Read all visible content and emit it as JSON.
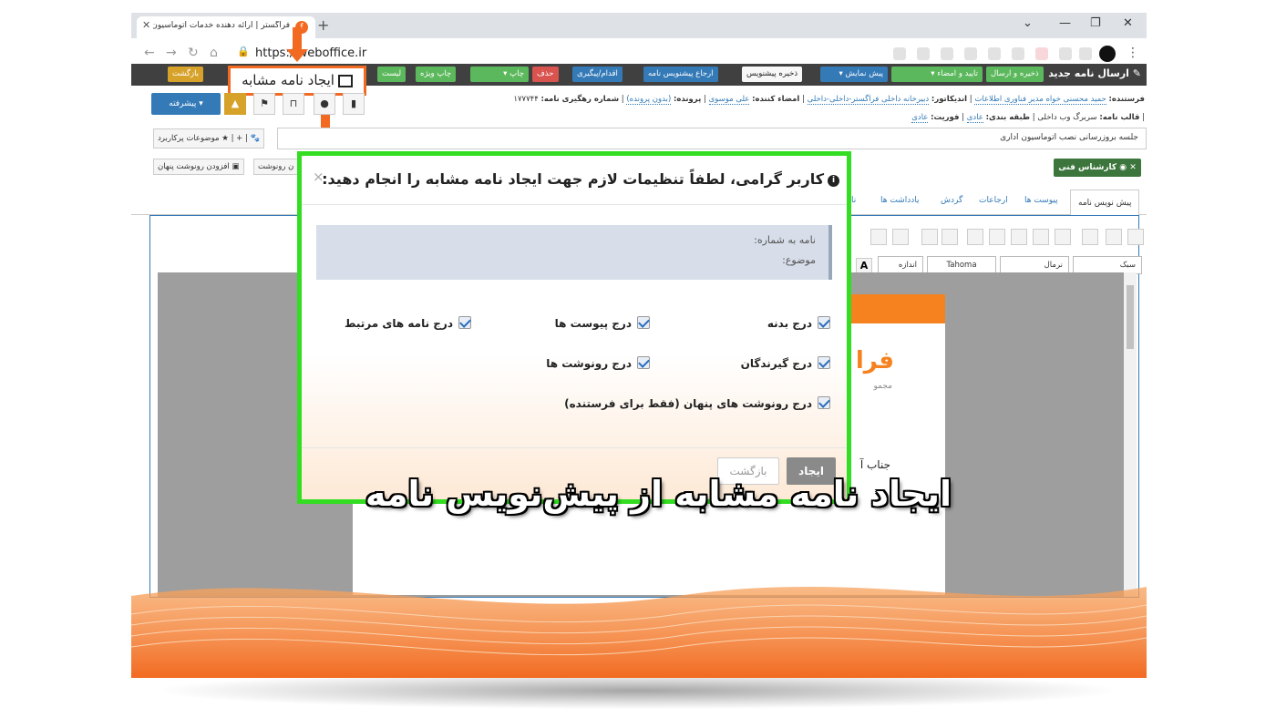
{
  "browser": {
    "tab_title": "فراگستر | ارائه دهنده خدمات اتوماسیون اد...",
    "favicon": "f",
    "url": "https://weboffice.ir"
  },
  "toolbar": {
    "title": "ارسال نامه جدید",
    "buttons": [
      "ذخیره و ارسال",
      "تایید و امضاء",
      "پیش نمایش",
      "ذخیره پیشنویس",
      "ارجاع پیشنویس نامه",
      "اقدام/پیگیری",
      "حذف",
      "چاپ",
      "چاپ ویژه",
      "لیست",
      "بازگشت"
    ]
  },
  "callout": {
    "label": "ایجاد نامه مشابه"
  },
  "actions": {
    "advanced_label": "پیشرفته"
  },
  "meta": {
    "line1": {
      "sender_label": "فرستنده:",
      "sender_value": "حمید محسنی خواه مدیر فناوری اطلاعات",
      "indicator_label": "اندیکاتور:",
      "indicator_value": "دبیرخانه داخلی فراگستر-داخلی-داخلی",
      "signer_label": "امضاء کننده:",
      "signer_value": "علی موسوی",
      "file_label": "پرونده:",
      "file_value": "(بدون پرونده)",
      "tracking_label": "شماره رهگیری نامه:",
      "tracking_value": "۱۷۷۷۴۴"
    },
    "line2": {
      "template_label": "قالب نامه:",
      "template_value": "سربرگ وب داخلی",
      "class_label": "طبقه بندی:",
      "class_value": "عادی",
      "priority_label": "فوریت:",
      "priority_value": "عادی"
    }
  },
  "subject": {
    "value": "جلسه بروزرسانی نصب اتوماسیون اداری",
    "frequent_topics": "موضوعات پرکاربرد",
    "add_hidden_cc": "افزودن رونوشت پنهان",
    "add_cc": "ن رونوشت"
  },
  "expert_badge": "کارشناس فنی",
  "tabs": [
    "پیش نویس نامه",
    "پیوست ها",
    "ارجاعات",
    "گردش",
    "یادداشت ها",
    "نا"
  ],
  "editor": {
    "combos": [
      "سبک",
      "نرمال",
      "Tahoma",
      "اندازه"
    ],
    "doc_logo": "فرا",
    "doc_sub": "مجمو",
    "doc_text": "جناب آ"
  },
  "modal": {
    "title": "کاربر گرامی، لطفاً تنظیمات لازم جهت ایجاد نامه مشابه را انجام دهید:",
    "close": "×",
    "info": {
      "number_label": "نامه به شماره:",
      "subject_label": "موضوع:"
    },
    "options": {
      "body": "درج بدنه",
      "attachments": "درج پیوست ها",
      "related": "درج نامه های مرتبط",
      "recipients": "درج گیرندگان",
      "cc": "درج رونوشت ها",
      "hidden_cc": "درج رونوشت های پنهان (فقط برای فرستنده)"
    },
    "create_button": "ایجاد",
    "back_button": "بازگشت"
  },
  "caption": "ایجاد نامه مشابه از پیش‌نویس نامه",
  "colors": {
    "accent_orange": "#f26a21",
    "highlight_green": "#33dd22",
    "toolbar_dark": "#404040"
  }
}
